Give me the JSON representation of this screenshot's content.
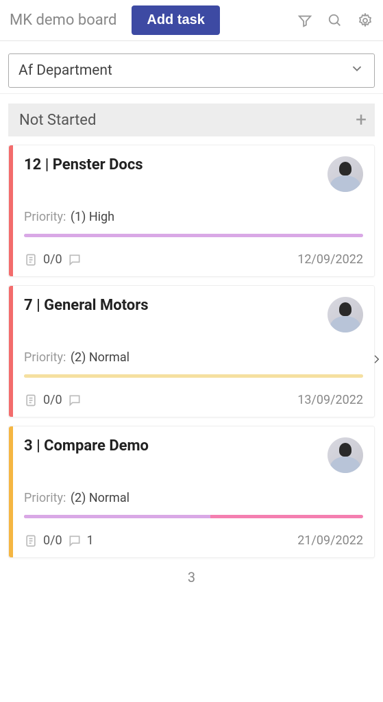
{
  "header": {
    "board_title": "MK demo board",
    "add_task_label": "Add task"
  },
  "filter_dropdown": {
    "selected": "Af Department"
  },
  "column": {
    "title": "Not Started",
    "count": "3"
  },
  "cards": [
    {
      "title": "12 | Penster Docs",
      "priority_label": "Priority:",
      "priority_value": "(1) High",
      "stripe_color": "red",
      "progress_color_1": "#d9a8e6",
      "progress_pct_1": 100,
      "checklist": "0/0",
      "comments": "",
      "date": "12/09/2022"
    },
    {
      "title": "7 | General Motors",
      "priority_label": "Priority:",
      "priority_value": "(2) Normal",
      "stripe_color": "red",
      "progress_color_1": "#f5e0a0",
      "progress_pct_1": 100,
      "checklist": "0/0",
      "comments": "",
      "date": "13/09/2022"
    },
    {
      "title": "3 | Compare Demo",
      "priority_label": "Priority:",
      "priority_value": "(2) Normal",
      "stripe_color": "yellow",
      "progress_color_1": "#d9a8e6",
      "progress_pct_1": 55,
      "progress_color_2": "#f47fb0",
      "progress_pct_2": 100,
      "checklist": "0/0",
      "comments": "1",
      "date": "21/09/2022"
    }
  ]
}
